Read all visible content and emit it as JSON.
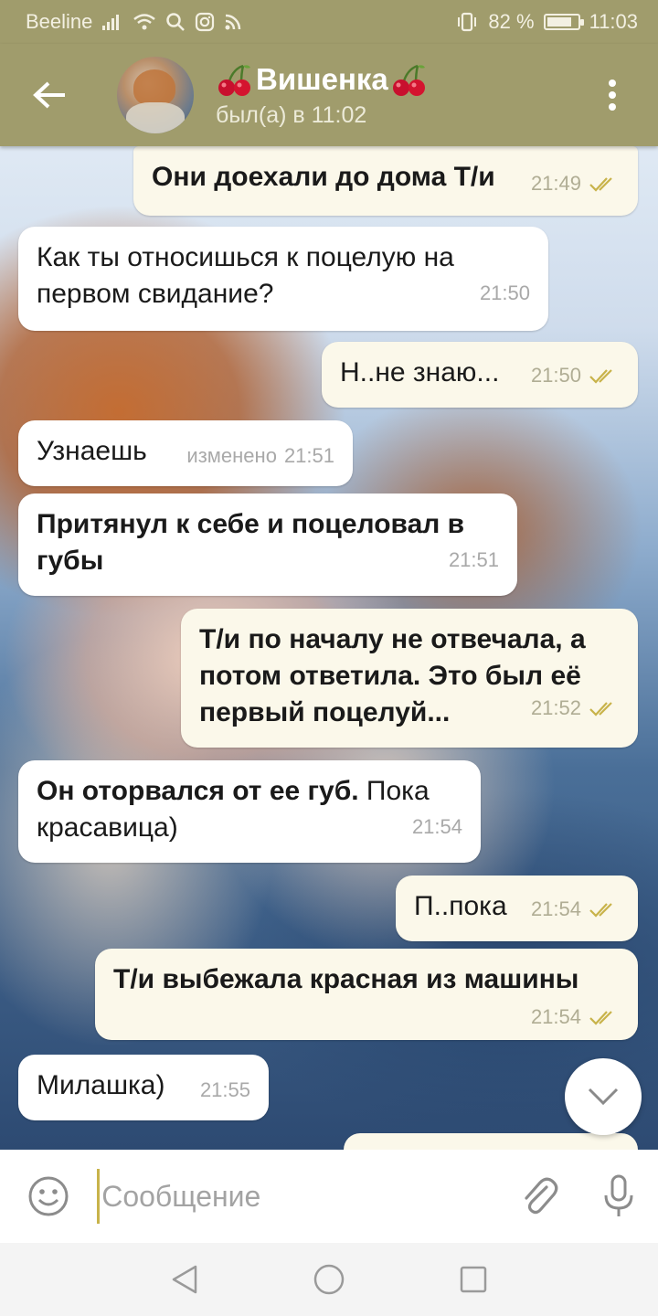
{
  "status_bar": {
    "carrier": "Beeline",
    "battery": "82 %",
    "battery_level": 0.82,
    "time": "11:03"
  },
  "header": {
    "title": "Вишенка",
    "status": "был(а) в 11:02",
    "title_emoji": "cherries-icon"
  },
  "messages": [
    {
      "dir": "out",
      "text": "Они доехали до дома Т/и",
      "time": "21:49",
      "read": true
    },
    {
      "dir": "in",
      "text": "Как ты относишься к поцелую на первом свидание?",
      "time": "21:50"
    },
    {
      "dir": "out",
      "text": "Н..не знаю...",
      "time": "21:50",
      "read": true
    },
    {
      "dir": "in",
      "text": "Узнаешь",
      "edited": "изменено",
      "time": "21:51"
    },
    {
      "dir": "in",
      "text": "Притянул к себе и поцеловал в губы",
      "time": "21:51"
    },
    {
      "dir": "out",
      "text": "Т/и по началу не отвечала, а потом ответила. Это был её первый поцелуй...",
      "time": "21:52",
      "read": true
    },
    {
      "dir": "in",
      "text_bold": "Он оторвался от ее губ.",
      "text": " Пока красавица)",
      "time": "21:54"
    },
    {
      "dir": "out",
      "text": "П..пока",
      "time": "21:54",
      "read": true
    },
    {
      "dir": "out",
      "text": "Т/и выбежала красная из машины",
      "time": "21:54",
      "read": true
    },
    {
      "dir": "in",
      "text": "Милашка)",
      "time": "21:55"
    }
  ],
  "input": {
    "placeholder": "Сообщение",
    "value": ""
  },
  "colors": {
    "header_bg": "#a09c6c",
    "incoming_bubble": "#ffffff",
    "outgoing_bubble": "#fbf8ea",
    "check_color": "#c8b34a"
  }
}
